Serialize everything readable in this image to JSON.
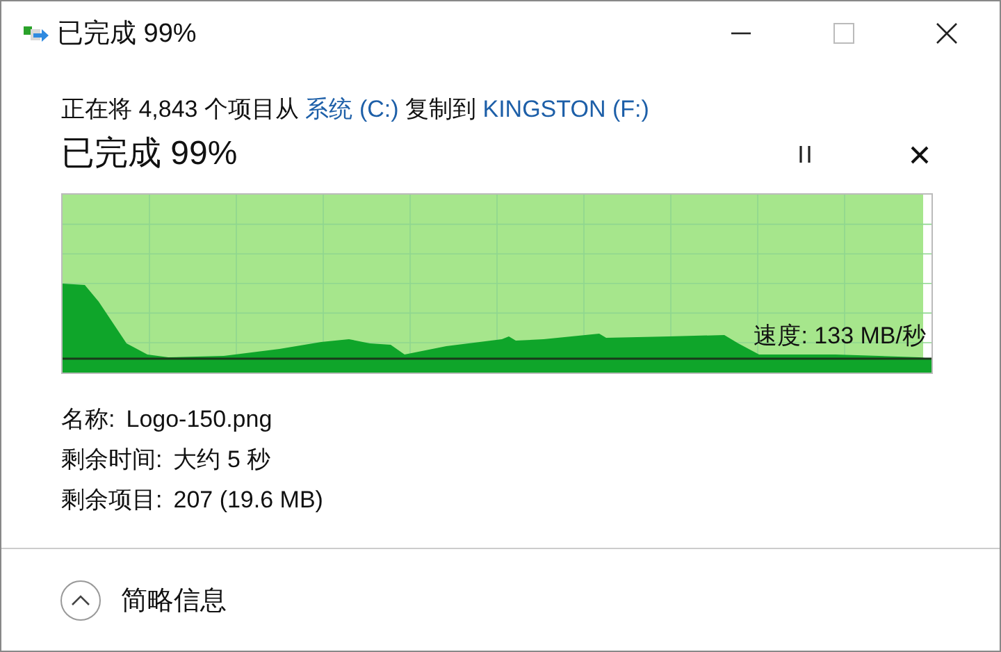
{
  "window": {
    "title": "已完成 99%"
  },
  "header": {
    "parts": [
      {
        "kind": "text",
        "text": "正在将 4,843 个项目从"
      },
      {
        "kind": "link",
        "text": "系统 (C:)"
      },
      {
        "kind": "text",
        "text": "复制到"
      },
      {
        "kind": "link",
        "text": "KINGSTON (F:)"
      }
    ]
  },
  "progress": {
    "title": "已完成 99%",
    "level": 0.99,
    "speed": "速度: 133 MB/秒"
  },
  "details": [
    {
      "label": "名称:",
      "value": "Logo-150.png"
    },
    {
      "label": "剩余时间:",
      "value": "大约 5 秒"
    },
    {
      "label": "剩余项目:",
      "value": "207 (19.6 MB)"
    }
  ],
  "footer": {
    "toggle": "简略信息"
  }
}
